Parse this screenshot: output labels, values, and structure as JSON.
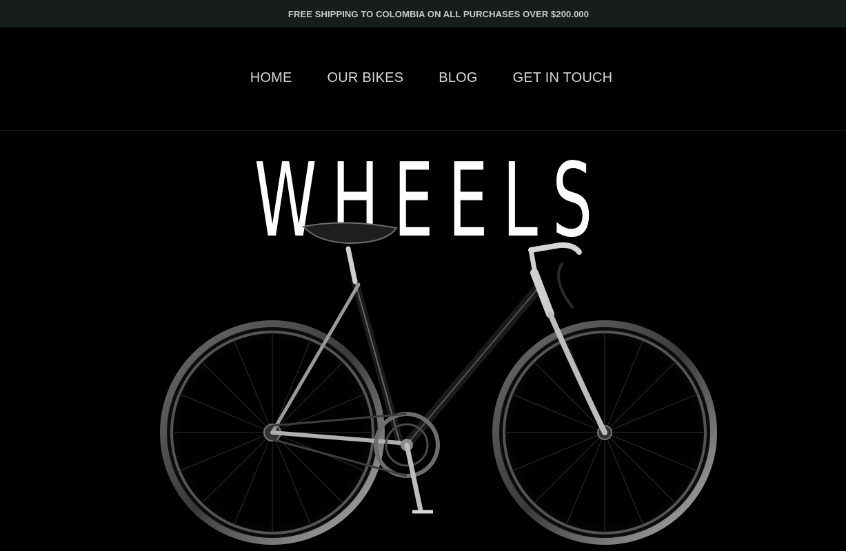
{
  "announcement": {
    "text": "FREE SHIPPING TO COLOMBIA ON ALL PURCHASES OVER $200.000"
  },
  "nav": {
    "items": [
      {
        "label": "HOME"
      },
      {
        "label": "OUR BIKES"
      },
      {
        "label": "BLOG"
      },
      {
        "label": "GET IN TOUCH"
      }
    ]
  },
  "hero": {
    "title": "WHEELS",
    "image_subject": "black-fixed-gear-bicycle"
  },
  "colors": {
    "page_background": "#000000",
    "announcement_background": "#171c1d",
    "announcement_text": "#c9cbcb",
    "nav_text": "#d6d6d6",
    "hero_title": "#ffffff"
  }
}
